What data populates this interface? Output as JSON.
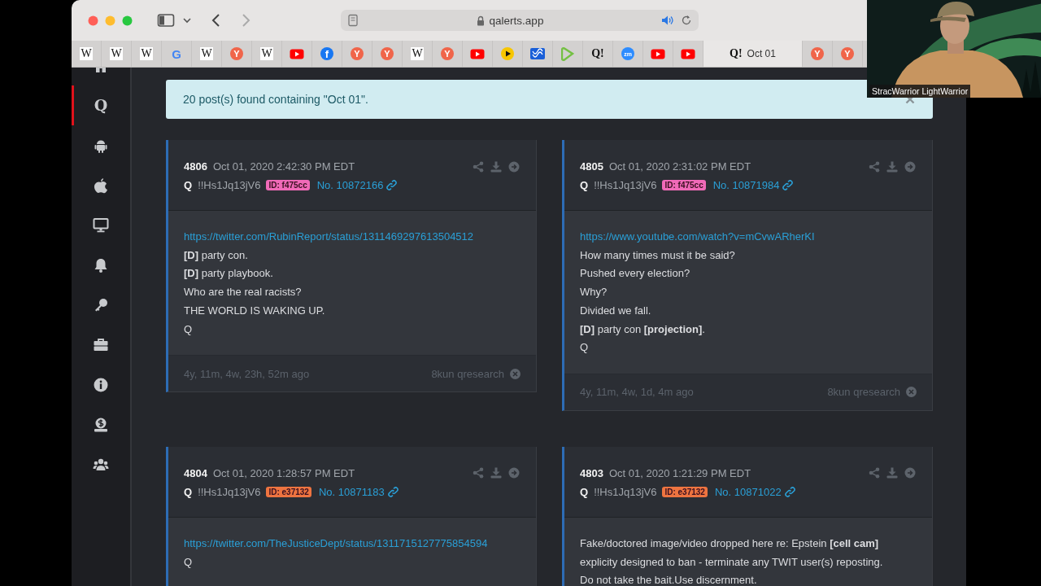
{
  "browser": {
    "address": "qalerts.app",
    "tabs": [
      {
        "kind": "wiki",
        "glyph": "W",
        "selected": false
      },
      {
        "kind": "wiki",
        "glyph": "W",
        "selected": false
      },
      {
        "kind": "wiki",
        "glyph": "W",
        "selected": false
      },
      {
        "kind": "google",
        "glyph": "G",
        "selected": false
      },
      {
        "kind": "wiki",
        "glyph": "W",
        "selected": false
      },
      {
        "kind": "ycircle",
        "glyph": "Y",
        "selected": false
      },
      {
        "kind": "wiki",
        "glyph": "W",
        "selected": false
      },
      {
        "kind": "youtube",
        "selected": false
      },
      {
        "kind": "facebook",
        "glyph": "f",
        "selected": false
      },
      {
        "kind": "ycircle",
        "glyph": "Y",
        "selected": false
      },
      {
        "kind": "ycircle",
        "glyph": "Y",
        "selected": false
      },
      {
        "kind": "wiki",
        "glyph": "W",
        "selected": false
      },
      {
        "kind": "ycircle",
        "glyph": "Y",
        "selected": false
      },
      {
        "kind": "youtube",
        "selected": false
      },
      {
        "kind": "play",
        "selected": false
      },
      {
        "kind": "abc",
        "selected": false
      },
      {
        "kind": "rumble",
        "selected": false
      },
      {
        "kind": "qalerts",
        "glyph": "Q!",
        "selected": false
      },
      {
        "kind": "zoom",
        "glyph": "zm",
        "selected": false
      },
      {
        "kind": "youtube",
        "selected": false
      },
      {
        "kind": "youtube",
        "selected": false
      },
      {
        "kind": "qalerts",
        "glyph": "Q!",
        "title": "Oct 01",
        "selected": true
      },
      {
        "kind": "ycircle",
        "glyph": "Y",
        "selected": false
      },
      {
        "kind": "ycircle",
        "glyph": "Y",
        "selected": false
      }
    ]
  },
  "sidebar": {
    "items": [
      {
        "kind": "home",
        "selected": false
      },
      {
        "kind": "q",
        "glyph": "Q",
        "selected": true
      },
      {
        "kind": "android",
        "selected": false
      },
      {
        "kind": "apple",
        "selected": false
      },
      {
        "kind": "desktop",
        "selected": false
      },
      {
        "kind": "bell",
        "selected": false
      },
      {
        "kind": "key",
        "selected": false
      },
      {
        "kind": "toolbox",
        "selected": false
      },
      {
        "kind": "info",
        "selected": false
      },
      {
        "kind": "donate",
        "selected": false
      },
      {
        "kind": "users",
        "selected": false
      }
    ]
  },
  "alert": {
    "message": "20 post(s) found containing \"Oct 01\"."
  },
  "posts": [
    {
      "number": "4806",
      "date": "Oct 01, 2020 2:42:30 PM EDT",
      "author": "Q",
      "tripcode": "!!Hs1Jq13jV6",
      "id_badge": {
        "text": "ID: f475cc",
        "color": "#f06ab8"
      },
      "post_no": "No. 10872166",
      "body": [
        {
          "kind": "link",
          "text": "https://twitter.com/RubinReport/status/1311469297613504512"
        },
        {
          "kind": "text",
          "text": "**[D]** party con."
        },
        {
          "kind": "text",
          "text": "**[D]** party playbook."
        },
        {
          "kind": "text",
          "text": "Who are the real racists?"
        },
        {
          "kind": "text",
          "text": "THE WORLD IS WAKING UP."
        },
        {
          "kind": "text",
          "text": "Q"
        }
      ],
      "footer": {
        "age": "4y, 11m, 4w, 23h, 52m ago",
        "source": "8kun qresearch"
      }
    },
    {
      "number": "4805",
      "date": "Oct 01, 2020 2:31:02 PM EDT",
      "author": "Q",
      "tripcode": "!!Hs1Jq13jV6",
      "id_badge": {
        "text": "ID: f475cc",
        "color": "#f06ab8"
      },
      "post_no": "No. 10871984",
      "body": [
        {
          "kind": "link",
          "text": "https://www.youtube.com/watch?v=mCvwARherKI"
        },
        {
          "kind": "text",
          "text": "How many times must it be said?"
        },
        {
          "kind": "text",
          "text": "Pushed every election?"
        },
        {
          "kind": "text",
          "text": "Why?"
        },
        {
          "kind": "text",
          "text": "Divided we fall."
        },
        {
          "kind": "text",
          "text": "**[D]** party con **[projection]**."
        },
        {
          "kind": "text",
          "text": "Q"
        }
      ],
      "footer": {
        "age": "4y, 11m, 4w, 1d, 4m ago",
        "source": "8kun qresearch"
      }
    },
    {
      "number": "4804",
      "date": "Oct 01, 2020 1:28:57 PM EDT",
      "author": "Q",
      "tripcode": "!!Hs1Jq13jV6",
      "id_badge": {
        "text": "ID: e37132",
        "color": "#ee7440"
      },
      "post_no": "No. 10871183",
      "body": [
        {
          "kind": "link",
          "text": "https://twitter.com/TheJusticeDept/status/1311715127775854594"
        },
        {
          "kind": "text",
          "text": "Q"
        }
      ]
    },
    {
      "number": "4803",
      "date": "Oct 01, 2020 1:21:29 PM EDT",
      "author": "Q",
      "tripcode": "!!Hs1Jq13jV6",
      "id_badge": {
        "text": "ID: e37132",
        "color": "#ee7440"
      },
      "post_no": "No. 10871022",
      "body": [
        {
          "kind": "text",
          "text": "Fake/doctored image/video dropped here re: Epstein **[cell cam]**"
        },
        {
          "kind": "text",
          "text": "explicity designed to ban - terminate any TWIT user(s) reposting."
        },
        {
          "kind": "text",
          "text": "Do not take the bait.Use discernment."
        }
      ]
    }
  ],
  "video": {
    "kind": "picture",
    "name_label": "StracWarrior LightWarrior"
  }
}
